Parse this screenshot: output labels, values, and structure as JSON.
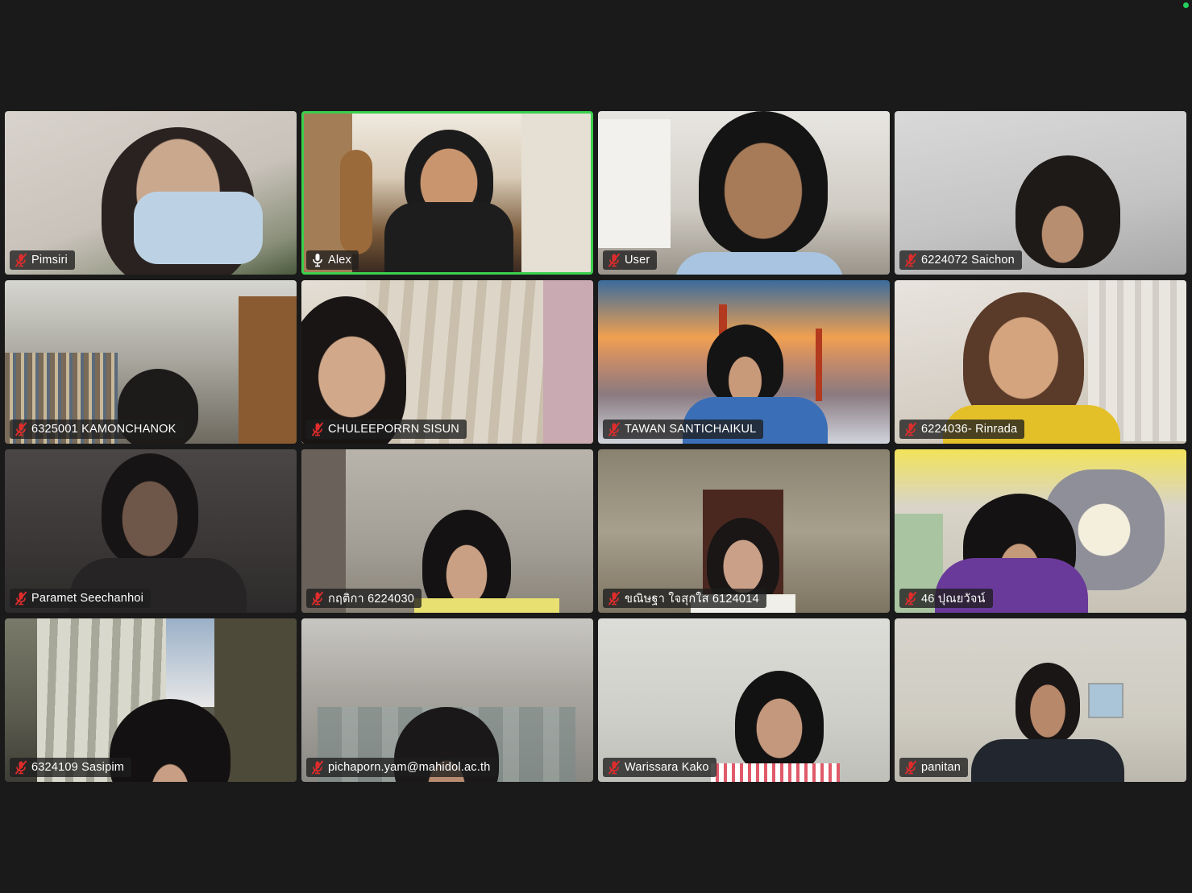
{
  "colors": {
    "background": "#1a1a1a",
    "active_speaker_border": "#3ccf4e",
    "muted_icon": "#e02c2c",
    "label_background": "rgba(30,30,30,0.78)"
  },
  "participants": [
    {
      "name": "Pimsiri",
      "mic": "muted",
      "speaking": false
    },
    {
      "name": "Alex",
      "mic": "unmuted",
      "speaking": true
    },
    {
      "name": "User",
      "mic": "muted",
      "speaking": false
    },
    {
      "name": "6224072 Saichon",
      "mic": "muted",
      "speaking": false
    },
    {
      "name": "6325001 KAMONCHANOK",
      "mic": "muted",
      "speaking": false
    },
    {
      "name": "CHULEEPORRN SISUN",
      "mic": "muted",
      "speaking": false
    },
    {
      "name": "TAWAN SANTICHAIKUL",
      "mic": "muted",
      "speaking": false
    },
    {
      "name": "6224036- Rinrada",
      "mic": "muted",
      "speaking": false
    },
    {
      "name": "Paramet Seechanhoi",
      "mic": "muted",
      "speaking": false
    },
    {
      "name": "กฤติกา 6224030",
      "mic": "muted",
      "speaking": false
    },
    {
      "name": "ขณิษฐา ใจสุกใส 6124014",
      "mic": "muted",
      "speaking": false
    },
    {
      "name": "46 ปุณยวัจน์",
      "mic": "muted",
      "speaking": false
    },
    {
      "name": "6324109 Sasipim",
      "mic": "muted",
      "speaking": false
    },
    {
      "name": "pichaporn.yam@mahidol.ac.th",
      "mic": "muted",
      "speaking": false
    },
    {
      "name": "Warissara Kako",
      "mic": "muted",
      "speaking": false
    },
    {
      "name": "panitan",
      "mic": "muted",
      "speaking": false
    }
  ]
}
